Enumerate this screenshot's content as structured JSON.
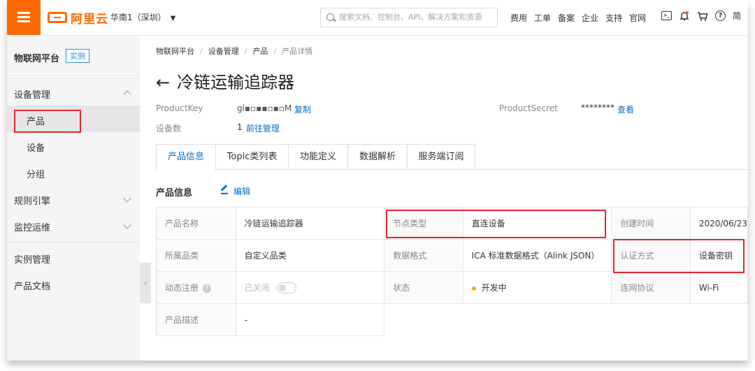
{
  "brand": {
    "name": "阿里云",
    "accent": "#ff6a00"
  },
  "topbar": {
    "region": "华南1（深圳）",
    "search_placeholder": "搜索文档、控制台、API、解决方案和资源",
    "links": [
      "费用",
      "工单",
      "备案",
      "企业",
      "支持",
      "官网"
    ],
    "console_icon": ">_",
    "bell_icon": "bell-icon",
    "cart_icon": "cart-icon",
    "help_icon": "?",
    "truncated": "简"
  },
  "sidebar": {
    "title": "物联网平台",
    "badge": "实例",
    "group1": "设备管理",
    "items": [
      "产品",
      "设备",
      "分组"
    ],
    "rules": "规则引擎",
    "monitor": "监控运维",
    "instance_mgmt": "实例管理",
    "product_docs": "产品文档",
    "collapse": "‹"
  },
  "breadcrumb": [
    "物联网平台",
    "设备管理",
    "产品",
    "产品详情"
  ],
  "page": {
    "back_arrow": "←",
    "title": "冷链运输追踪器",
    "product_key_label": "ProductKey",
    "product_key_value": "gl▪▫▪▪▫▪▫M",
    "copy": "复制",
    "product_secret_label": "ProductSecret",
    "product_secret_value": "********",
    "view": "查看",
    "device_count_label": "设备数",
    "device_count_value": "1",
    "go_manage": "前往管理"
  },
  "tabs": [
    "产品信息",
    "Topic类列表",
    "功能定义",
    "数据解析",
    "服务端订阅"
  ],
  "section": {
    "title": "产品信息",
    "edit": "编辑"
  },
  "info": {
    "rows": [
      [
        [
          "产品名称",
          "冷链运输追踪器"
        ],
        [
          "节点类型",
          "直连设备"
        ],
        [
          "创建时间",
          "2020/06/23"
        ]
      ],
      [
        [
          "所属品类",
          "自定义品类"
        ],
        [
          "数据格式",
          "ICA 标准数据格式（Alink JSON）"
        ],
        [
          "认证方式",
          "设备密钥"
        ]
      ],
      [
        [
          "动态注册",
          "已关闭"
        ],
        [
          "状态",
          "开发中"
        ],
        [
          "连网协议",
          "Wi-Fi"
        ]
      ],
      [
        [
          "产品描述",
          "-"
        ]
      ]
    ],
    "dynamic_reg_help": "?"
  }
}
